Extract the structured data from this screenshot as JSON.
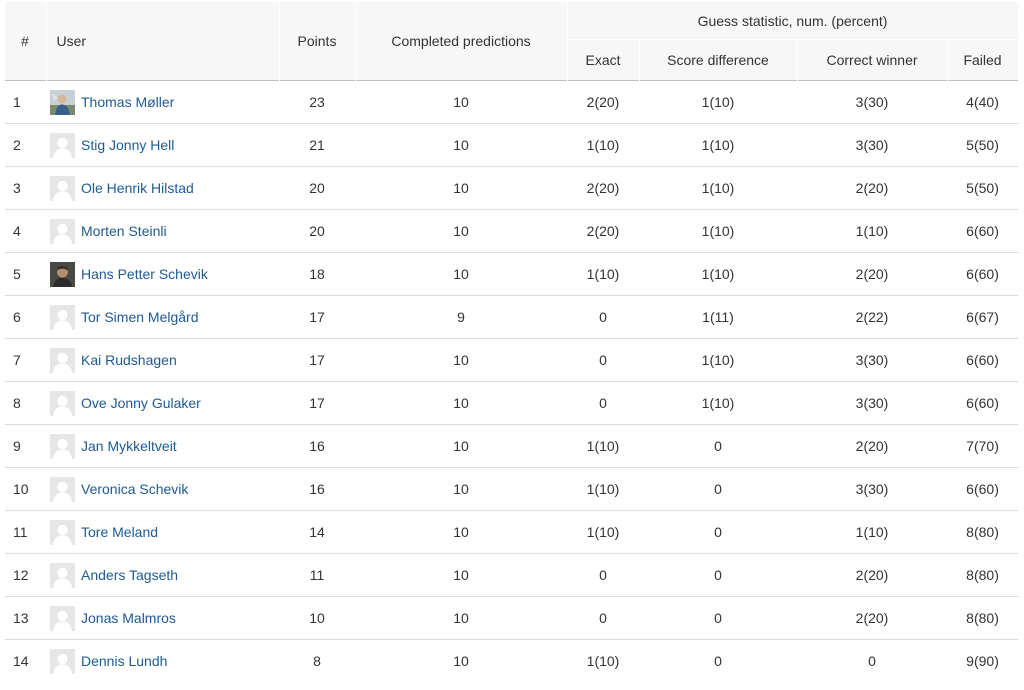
{
  "headers": {
    "rank": "#",
    "user": "User",
    "points": "Points",
    "completed": "Completed predictions",
    "guess_group": "Guess statistic, num. (percent)",
    "exact": "Exact",
    "score_diff": "Score difference",
    "correct_winner": "Correct winner",
    "failed": "Failed"
  },
  "rows": [
    {
      "rank": "1",
      "name": "Thomas Møller",
      "avatar": "photo-avatar-1",
      "points": "23",
      "completed": "10",
      "exact": "2(20)",
      "score_diff": "1(10)",
      "correct_winner": "3(30)",
      "failed": "4(40)"
    },
    {
      "rank": "2",
      "name": "Stig Jonny Hell",
      "avatar": "default-avatar",
      "points": "21",
      "completed": "10",
      "exact": "1(10)",
      "score_diff": "1(10)",
      "correct_winner": "3(30)",
      "failed": "5(50)"
    },
    {
      "rank": "3",
      "name": "Ole Henrik Hilstad",
      "avatar": "default-avatar",
      "points": "20",
      "completed": "10",
      "exact": "2(20)",
      "score_diff": "1(10)",
      "correct_winner": "2(20)",
      "failed": "5(50)"
    },
    {
      "rank": "4",
      "name": "Morten Steinli",
      "avatar": "default-avatar",
      "points": "20",
      "completed": "10",
      "exact": "2(20)",
      "score_diff": "1(10)",
      "correct_winner": "1(10)",
      "failed": "6(60)"
    },
    {
      "rank": "5",
      "name": "Hans Petter Schevik",
      "avatar": "photo-avatar-2",
      "points": "18",
      "completed": "10",
      "exact": "1(10)",
      "score_diff": "1(10)",
      "correct_winner": "2(20)",
      "failed": "6(60)"
    },
    {
      "rank": "6",
      "name": "Tor Simen Melgård",
      "avatar": "default-avatar",
      "points": "17",
      "completed": "9",
      "exact": "0",
      "score_diff": "1(11)",
      "correct_winner": "2(22)",
      "failed": "6(67)"
    },
    {
      "rank": "7",
      "name": "Kai Rudshagen",
      "avatar": "default-avatar",
      "points": "17",
      "completed": "10",
      "exact": "0",
      "score_diff": "1(10)",
      "correct_winner": "3(30)",
      "failed": "6(60)"
    },
    {
      "rank": "8",
      "name": "Ove Jonny Gulaker",
      "avatar": "default-avatar",
      "points": "17",
      "completed": "10",
      "exact": "0",
      "score_diff": "1(10)",
      "correct_winner": "3(30)",
      "failed": "6(60)"
    },
    {
      "rank": "9",
      "name": "Jan Mykkeltveit",
      "avatar": "default-avatar",
      "points": "16",
      "completed": "10",
      "exact": "1(10)",
      "score_diff": "0",
      "correct_winner": "2(20)",
      "failed": "7(70)"
    },
    {
      "rank": "10",
      "name": "Veronica Schevik",
      "avatar": "default-avatar",
      "points": "16",
      "completed": "10",
      "exact": "1(10)",
      "score_diff": "0",
      "correct_winner": "3(30)",
      "failed": "6(60)"
    },
    {
      "rank": "11",
      "name": "Tore Meland",
      "avatar": "default-avatar",
      "points": "14",
      "completed": "10",
      "exact": "1(10)",
      "score_diff": "0",
      "correct_winner": "1(10)",
      "failed": "8(80)"
    },
    {
      "rank": "12",
      "name": "Anders Tagseth",
      "avatar": "default-avatar",
      "points": "11",
      "completed": "10",
      "exact": "0",
      "score_diff": "0",
      "correct_winner": "2(20)",
      "failed": "8(80)"
    },
    {
      "rank": "13",
      "name": "Jonas Malmros",
      "avatar": "default-avatar",
      "points": "10",
      "completed": "10",
      "exact": "0",
      "score_diff": "0",
      "correct_winner": "2(20)",
      "failed": "8(80)"
    },
    {
      "rank": "14",
      "name": "Dennis Lundh",
      "avatar": "default-avatar",
      "points": "8",
      "completed": "10",
      "exact": "1(10)",
      "score_diff": "0",
      "correct_winner": "0",
      "failed": "9(90)"
    }
  ]
}
